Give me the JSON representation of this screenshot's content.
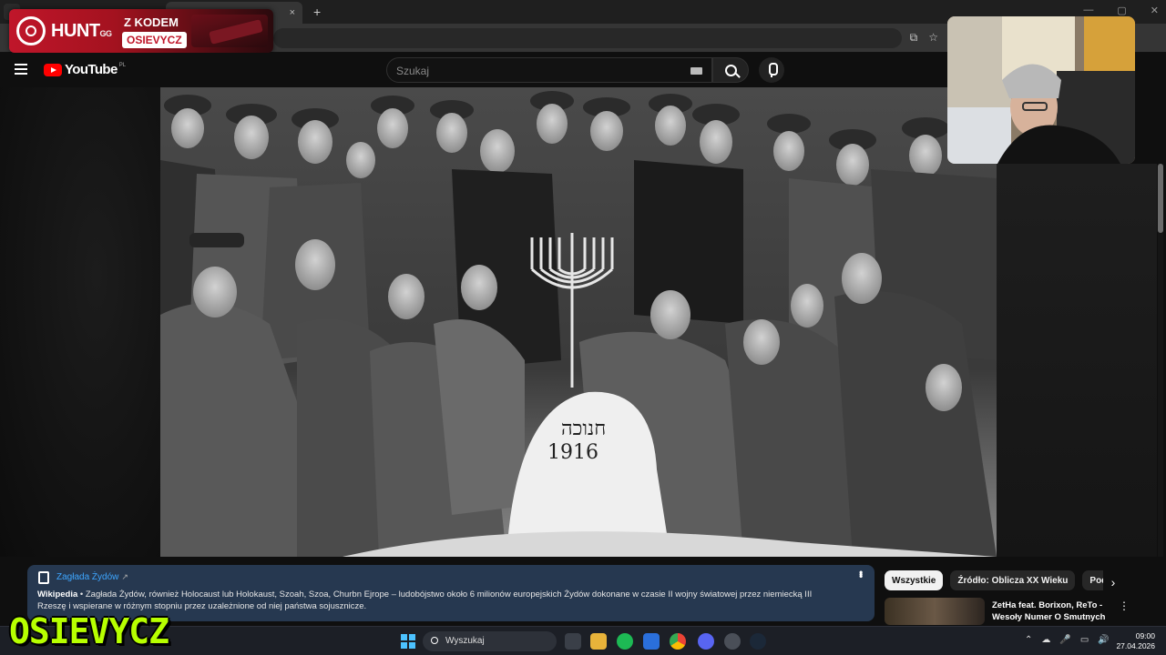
{
  "browser": {
    "tab_close": "×",
    "new_tab": "+",
    "window_controls": [
      "—",
      "▢",
      "✕"
    ]
  },
  "sponsor": {
    "brand": "HUNT",
    "brand_suffix": "GG",
    "line1": "Z KODEM",
    "code": "OSIEVYCZ"
  },
  "youtube": {
    "logo_text": "YouTube",
    "country": "PL",
    "search_placeholder": "Szukaj"
  },
  "info_panel": {
    "title": "Zagłada Żydów",
    "source": "Wikipedia",
    "text": " • Zagłada Żydów, również Holocaust lub Holokaust, Szoah, Szoa, Churbn Ejrope – ludobójstwo około 6 milionów europejskich Żydów dokonane w czasie II wojny światowej przez niemiecką III Rzeszę i wspierane w różnym stopniu przez uzależnione od niej państwa sojusznicze."
  },
  "video_overlay": {
    "snow_text_hebrew": "חנוכה",
    "snow_text_year": "1916"
  },
  "chips": [
    "Wszystkie",
    "Źródło: Oblicza XX Wieku",
    "Podobne"
  ],
  "recommended": {
    "title": "ZetHa feat. Borixon, ReTo - Wesoły Numer O Smutnych ..."
  },
  "taskbar": {
    "search_label": "Wyszukaj",
    "time": "09:00",
    "date": "27.04.2026"
  },
  "streamer_name": "OSIEVYCZ",
  "colors": {
    "accent_link": "#3ea6ff",
    "youtube_red": "#ff0000",
    "info_bg": "#263850",
    "streamer_green": "#b7ff00",
    "sponsor_red": "#c0162a"
  }
}
